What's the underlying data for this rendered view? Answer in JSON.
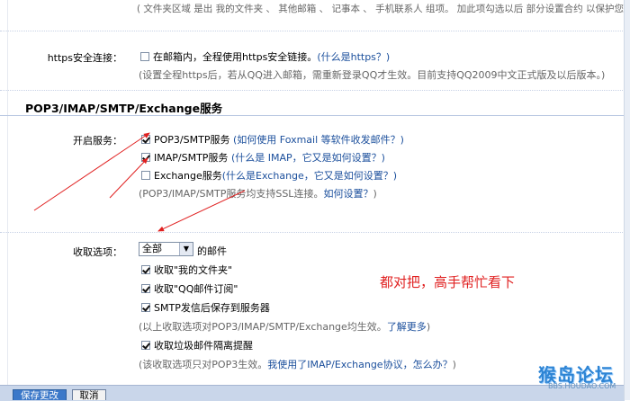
{
  "top_section": {
    "hint": "( 文件夹区域 是出 我的文件夹 、 其他邮箱 、 记事本 、 手机联系人 组项。 加此项勾选以后 部分设置合约 以保护您的设置 )"
  },
  "https": {
    "label": "https安全连接：",
    "checkbox_text": "在邮箱内，全程使用https安全链接。",
    "link": "(什么是https？)",
    "note": "(设置全程https后，若从QQ进入邮箱，需重新登录QQ才生效。目前支持QQ2009中文正式版及以后版本。)"
  },
  "section": {
    "title": "POP3/IMAP/SMTP/Exchange服务"
  },
  "services": {
    "label": "开启服务：",
    "items": [
      {
        "text": "POP3/SMTP服务",
        "link": "(如何使用 Foxmail 等软件收发邮件？)",
        "checked": true
      },
      {
        "text": "IMAP/SMTP服务",
        "link": "(什么是 IMAP，它又是如何设置？)",
        "checked": true
      },
      {
        "text": "Exchange服务",
        "link": "(什么是Exchange，它又是如何设置？)",
        "checked": false
      }
    ],
    "note": "(POP3/IMAP/SMTP服务均支持SSL连接。",
    "note_link": "如何设置？",
    "note_end": ")"
  },
  "receive": {
    "label": "收取选项：",
    "select_value": "全部",
    "select_suffix": "的邮件",
    "options": [
      {
        "text": "收取\"我的文件夹\"",
        "checked": true
      },
      {
        "text": "收取\"QQ邮件订阅\"",
        "checked": true
      },
      {
        "text": "SMTP发信后保存到服务器",
        "checked": true
      }
    ],
    "note1": "(以上收取选项对POP3/IMAP/SMTP/Exchange均生效。",
    "note1_link": "了解更多",
    "note1_end": ")",
    "spam_option": {
      "text": "收取垃圾邮件隔离提醒",
      "checked": true
    },
    "note2": "(该收取选项只对POP3生效。",
    "note2_link": "我使用了IMAP/Exchange协议，怎么办？",
    "note2_end": ")"
  },
  "annotation": "都对把，高手帮忙看下",
  "buttons": {
    "save": "保存更改",
    "cancel": "取消"
  },
  "watermark": {
    "title": "猴岛论坛",
    "url": "BBS.HOUDAO.COM"
  },
  "colors": {
    "link": "#1b4f9c",
    "annotation": "#e02020",
    "save_button": "#3b78c9",
    "bottom_bar": "#c9d6ea"
  }
}
